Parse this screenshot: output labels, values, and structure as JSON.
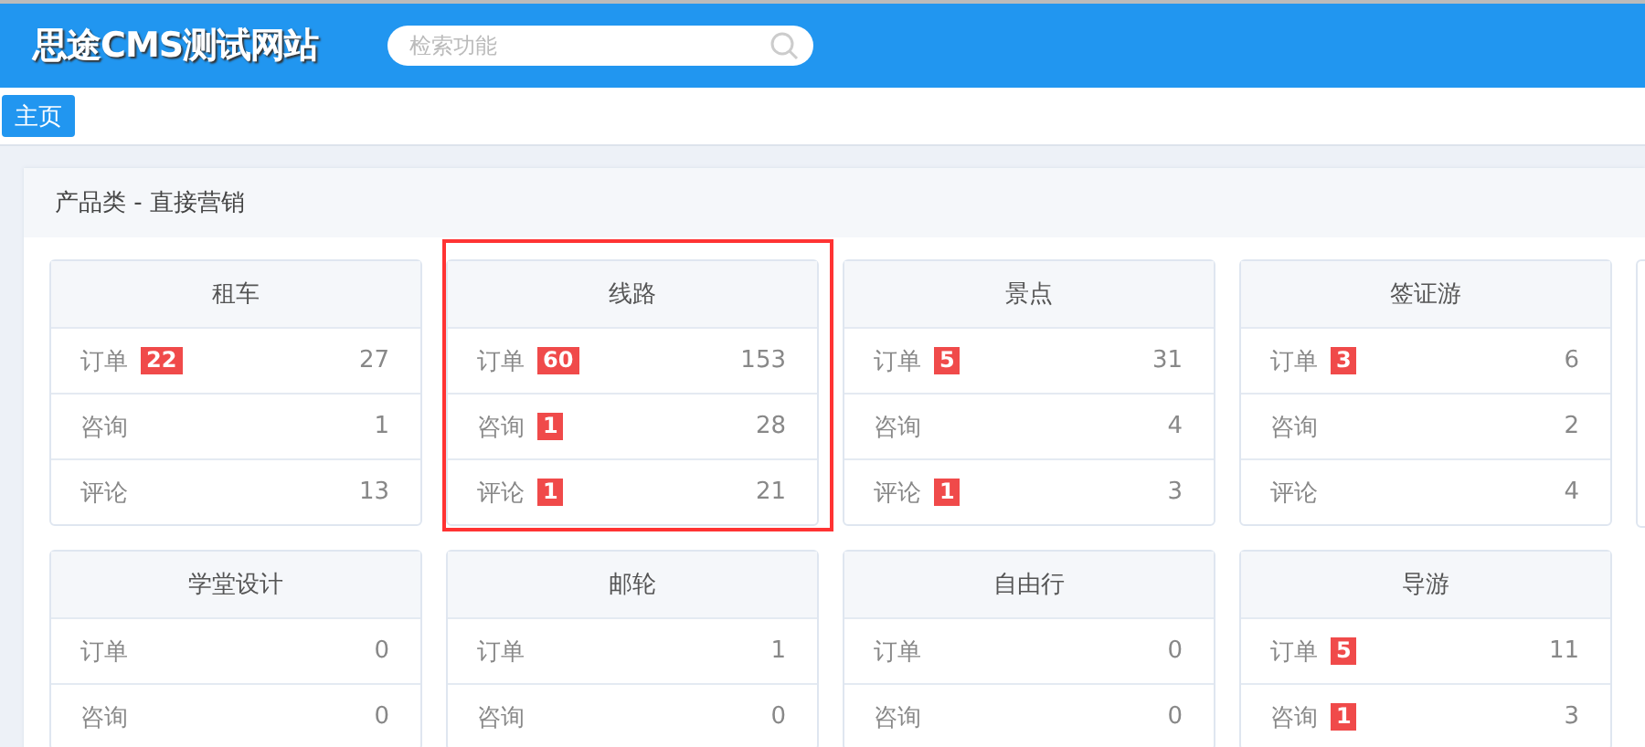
{
  "header": {
    "site_title": "思途CMS测试网站",
    "search": {
      "placeholder": "检索功能"
    }
  },
  "tabs": [
    {
      "label": "主页",
      "selected": true
    }
  ],
  "panel": {
    "title": "产品类 - 直接营销",
    "cards": [
      {
        "title": "租车",
        "highlighted": false,
        "rows": [
          {
            "label": "订单",
            "badge": "22",
            "count": "27"
          },
          {
            "label": "咨询",
            "count": "1"
          },
          {
            "label": "评论",
            "count": "13"
          }
        ]
      },
      {
        "title": "线路",
        "highlighted": true,
        "rows": [
          {
            "label": "订单",
            "badge": "60",
            "count": "153"
          },
          {
            "label": "咨询",
            "badge": "1",
            "count": "28"
          },
          {
            "label": "评论",
            "badge": "1",
            "count": "21"
          }
        ]
      },
      {
        "title": "景点",
        "highlighted": false,
        "rows": [
          {
            "label": "订单",
            "badge": "5",
            "count": "31"
          },
          {
            "label": "咨询",
            "count": "4"
          },
          {
            "label": "评论",
            "badge": "1",
            "count": "3"
          }
        ]
      },
      {
        "title": "签证游",
        "highlighted": false,
        "rows": [
          {
            "label": "订单",
            "badge": "3",
            "count": "6"
          },
          {
            "label": "咨询",
            "count": "2"
          },
          {
            "label": "评论",
            "count": "4"
          }
        ]
      },
      {
        "title": "学堂设计",
        "highlighted": false,
        "rows": [
          {
            "label": "订单",
            "count": "0"
          },
          {
            "label": "咨询",
            "count": "0"
          }
        ]
      },
      {
        "title": "邮轮",
        "highlighted": false,
        "rows": [
          {
            "label": "订单",
            "count": "1"
          },
          {
            "label": "咨询",
            "count": "0"
          }
        ]
      },
      {
        "title": "自由行",
        "highlighted": false,
        "rows": [
          {
            "label": "订单",
            "count": "0"
          },
          {
            "label": "咨询",
            "count": "0"
          }
        ]
      },
      {
        "title": "导游",
        "highlighted": false,
        "rows": [
          {
            "label": "订单",
            "badge": "5",
            "count": "11"
          },
          {
            "label": "咨询",
            "badge": "1",
            "count": "3"
          }
        ]
      }
    ]
  }
}
